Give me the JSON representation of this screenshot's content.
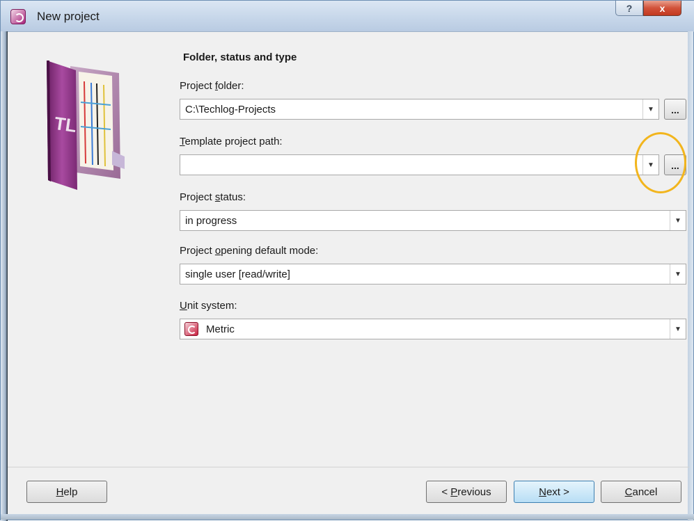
{
  "window": {
    "title": "New project",
    "help_glyph": "?",
    "close_glyph": "x"
  },
  "section": {
    "heading": "Folder, status and type"
  },
  "fields": {
    "project_folder": {
      "label_pre": "Project ",
      "label_accel": "f",
      "label_post": "older:",
      "value": "C:\\Techlog-Projects",
      "browse_label": "..."
    },
    "template_path": {
      "label_pre": "",
      "label_accel": "T",
      "label_post": "emplate project path:",
      "value": "",
      "browse_label": "..."
    },
    "project_status": {
      "label_pre": "Project ",
      "label_accel": "s",
      "label_post": "tatus:",
      "value": "in progress"
    },
    "opening_mode": {
      "label_pre": "Project ",
      "label_accel": "o",
      "label_post": "pening default mode:",
      "value": "single user [read/write]"
    },
    "unit_system": {
      "label_pre": "",
      "label_accel": "U",
      "label_post": "nit system:",
      "value": "Metric",
      "icon": "techlog-unit-icon"
    }
  },
  "buttons": {
    "help": {
      "pre": "",
      "accel": "H",
      "post": "elp"
    },
    "previous": {
      "pre": "< ",
      "accel": "P",
      "post": "revious"
    },
    "next": {
      "pre": "",
      "accel": "N",
      "post": "ext >"
    },
    "cancel": {
      "pre": "",
      "accel": "C",
      "post": "ancel"
    }
  },
  "icons": {
    "app": "techlog-app-icon",
    "side": "techlog-folder-illustration",
    "dropdown": "chevron-down-icon"
  },
  "colors": {
    "titlebar": "#c7d7ea",
    "close_button": "#d2523a",
    "highlight_ring": "#f2b51d",
    "primary_button": "#b8def5",
    "brand_purple": "#8e2b86"
  }
}
